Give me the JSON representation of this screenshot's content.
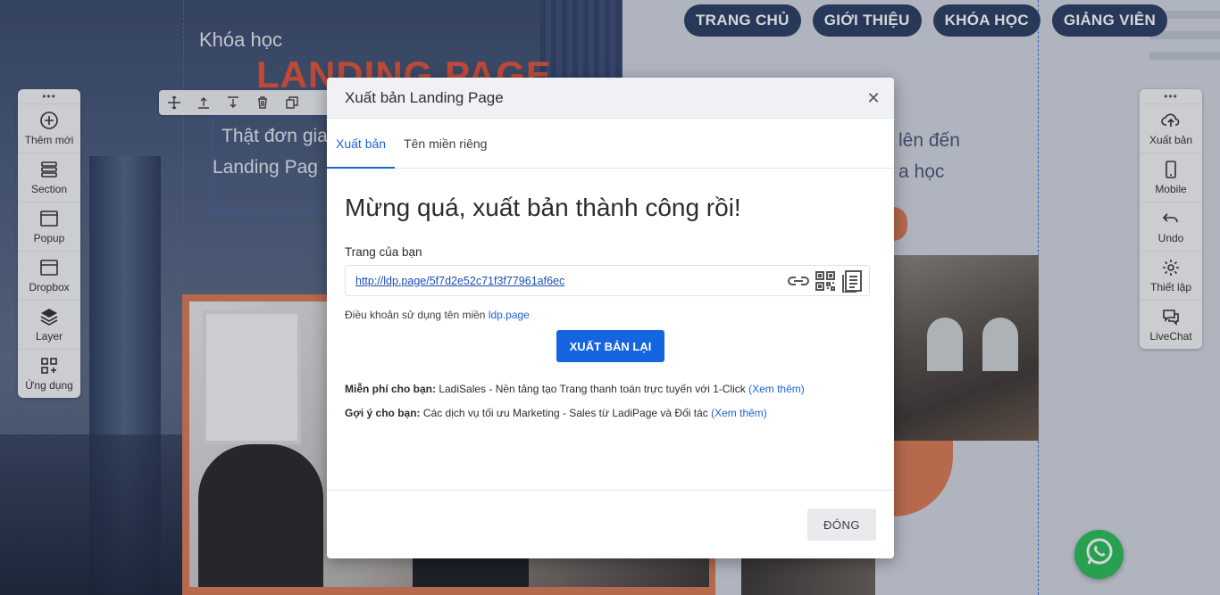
{
  "nav": {
    "items": [
      "TRANG CHỦ",
      "GIỚI THIỆU",
      "KHÓA HỌC",
      "GIẢNG VIÊN"
    ]
  },
  "hero": {
    "label": "Khóa học",
    "title": "LANDING PAGE",
    "sub_line1": "Thật đơn gia",
    "sub_line2": "Landing Pag",
    "right_line1": "lên đến",
    "right_line2": "a học"
  },
  "left_toolbar": {
    "items": [
      {
        "label": "Thêm mới",
        "icon": "plus-circle-icon"
      },
      {
        "label": "Section",
        "icon": "section-icon"
      },
      {
        "label": "Popup",
        "icon": "popup-icon"
      },
      {
        "label": "Dropbox",
        "icon": "dropbox-icon"
      },
      {
        "label": "Layer",
        "icon": "layers-icon"
      },
      {
        "label": "Ứng dụng",
        "icon": "apps-icon"
      }
    ]
  },
  "right_toolbar": {
    "items": [
      {
        "label": "Xuất bản",
        "icon": "cloud-upload-icon"
      },
      {
        "label": "Mobile",
        "icon": "mobile-icon"
      },
      {
        "label": "Undo",
        "icon": "undo-icon"
      },
      {
        "label": "Thiết lập",
        "icon": "gear-icon"
      },
      {
        "label": "LiveChat",
        "icon": "chat-icon"
      }
    ]
  },
  "modal": {
    "title": "Xuất bản Landing Page",
    "tabs": [
      "Xuất bản",
      "Tên miền riêng"
    ],
    "headline": "Mừng quá, xuất bản thành công rồi!",
    "page_label": "Trang của bạn",
    "page_url": "http://ldp.page/5f7d2e52c71f3f77961af6ec",
    "terms_text": "Điều khoản sử dụng tên miền ",
    "terms_link": "ldp.page",
    "republish_label": "XUẤT BẢN LẠI",
    "promo1_bold": "Miễn phí cho bạn:",
    "promo1_text": " LadiSales - Nền tảng tạo Trang thanh toán trực tuyến với 1-Click ",
    "promo1_link": "(Xem thêm)",
    "promo2_bold": "Gợi ý cho bạn:",
    "promo2_text": " Các dịch vụ tối ưu Marketing - Sales từ LadiPage và Đối tác ",
    "promo2_link": "(Xem thêm)",
    "close_label": "ĐÓNG"
  },
  "colors": {
    "primary": "#1565e0",
    "nav_bg": "#2d3f63",
    "accent_orange": "#d97a55",
    "whatsapp": "#2bbe58"
  }
}
